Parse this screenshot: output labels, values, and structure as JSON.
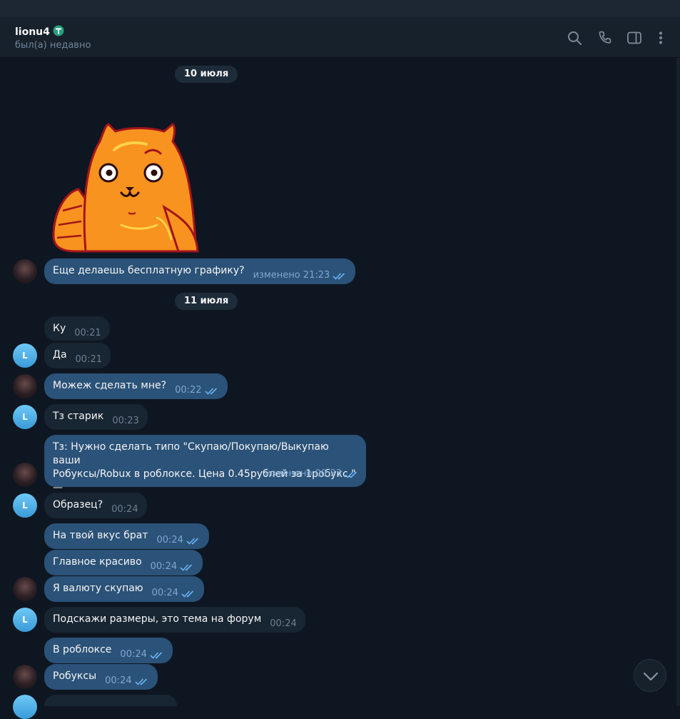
{
  "header": {
    "name": "lionu4",
    "status": "был(а) недавно",
    "icons": [
      "search-icon",
      "phone-icon",
      "sidebar-toggle-icon",
      "more-vert-icon"
    ]
  },
  "dates": [
    "10 июля",
    "11 июля"
  ],
  "contact_avatar_letter": "L",
  "messages": [
    {
      "text": "Еще делаешь бесплатную графику?",
      "time": "изменено 21:23"
    },
    {
      "text": "Ку",
      "time": "00:21"
    },
    {
      "text": "Да",
      "time": "00:21"
    },
    {
      "text": "Можеж сделать мне?",
      "time": "00:22"
    },
    {
      "text": "Тз старик",
      "time": "00:23"
    },
    {
      "line1": "Тз: Нужно сделать типо \"Скупаю/Покупаю/Выкупаю ваши",
      "line2": "Робуксы/Robux в роблоксе. Цена 0.45рублей за 1робукс.\" —",
      "line3": "MiZaRuS  Байер",
      "time": "изменено 00:23"
    },
    {
      "text": "Образец?",
      "time": "00:24"
    },
    {
      "text": "На твой вкус брат",
      "time": "00:24"
    },
    {
      "text": "Главное красиво",
      "time": "00:24"
    },
    {
      "text": "Я валюту скупаю",
      "time": "00:24"
    },
    {
      "text": "Подскажи размеры, это тема на форум",
      "time": "00:24"
    },
    {
      "text": "В роблоксе",
      "time": "00:24"
    },
    {
      "text": "Робуксы",
      "time": "00:24"
    }
  ],
  "colors": {
    "background": "#0e1621",
    "header": "#17212b",
    "incoming_bubble": "#182533",
    "outgoing_bubble": "#2b5278",
    "accent": "#6ab3f3"
  }
}
